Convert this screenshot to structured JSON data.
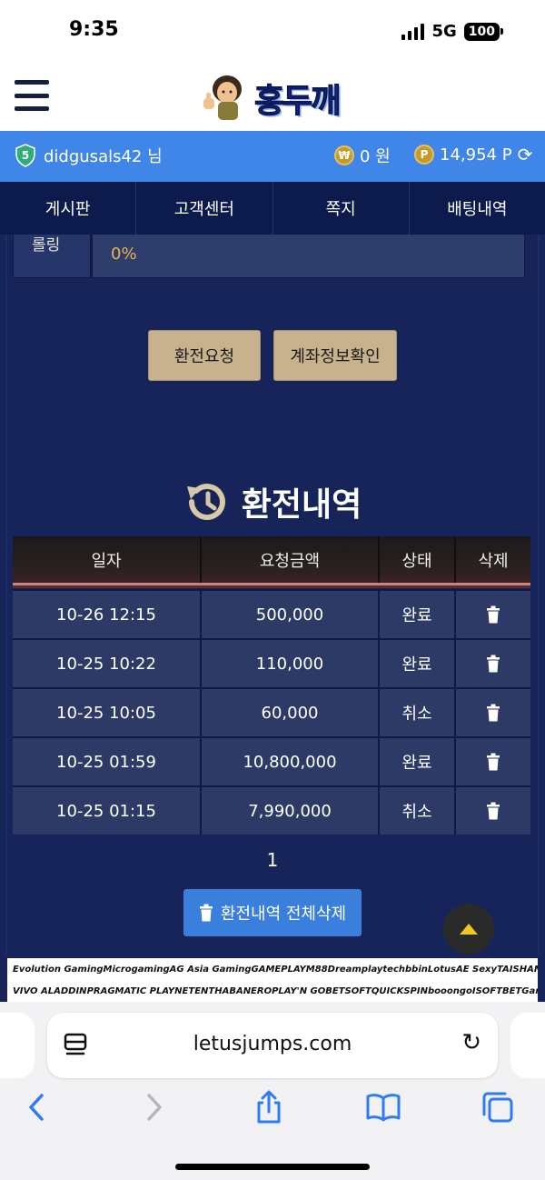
{
  "status": {
    "time": "9:35",
    "network": "5G",
    "battery": "100"
  },
  "header": {
    "logo_text": "홍두깨"
  },
  "user": {
    "username": "didgusals42 님",
    "money": "0 원",
    "money_coin": "₩",
    "points": "14,954 P",
    "points_coin": "P"
  },
  "nav": {
    "items": [
      {
        "label": "게시판"
      },
      {
        "label": "고객센터"
      },
      {
        "label": "쪽지"
      },
      {
        "label": "배팅내역"
      }
    ]
  },
  "rolling": {
    "label": "롤링",
    "value": "0%"
  },
  "buttons": {
    "exchange_request": "환전요청",
    "account_info": "계좌정보확인"
  },
  "history": {
    "title": "환전내역",
    "columns": [
      "일자",
      "요청금액",
      "상태",
      "삭제"
    ],
    "rows": [
      {
        "date": "10-26 12:15",
        "amount": "500,000",
        "status": "완료"
      },
      {
        "date": "10-25 10:22",
        "amount": "110,000",
        "status": "완료"
      },
      {
        "date": "10-25 10:05",
        "amount": "60,000",
        "status": "취소"
      },
      {
        "date": "10-25 01:59",
        "amount": "10,800,000",
        "status": "완료"
      },
      {
        "date": "10-25 01:15",
        "amount": "7,990,000",
        "status": "취소"
      }
    ],
    "page": "1",
    "delete_all": "환전내역 전체삭제"
  },
  "partners": {
    "row1": [
      "Evolution Gaming",
      "Microgaming",
      "AG Asia Gaming",
      "GAMEPLAY",
      "M88",
      "Dream",
      "playtech",
      "bbin",
      "Lotus",
      "AE Sexy",
      "TAISHAN"
    ],
    "row2": [
      "VIVO ALADDIN",
      "PRAGMATIC PLAY",
      "NETENT",
      "HABANERO",
      "PLAY'N GO",
      "BETSOFT",
      "QUICKSPIN",
      "booongo",
      "ISOFTBET",
      "Gamatron"
    ]
  },
  "browser": {
    "url": "letusjumps.com"
  },
  "colors": {
    "user_bar": "#3f86e8",
    "nav_bg": "#0c1a4c",
    "content_bg": "#17245a",
    "tan_button": "#c8b28e",
    "delete_button": "#3a7fdc",
    "accent_gold": "#e8b64a"
  }
}
